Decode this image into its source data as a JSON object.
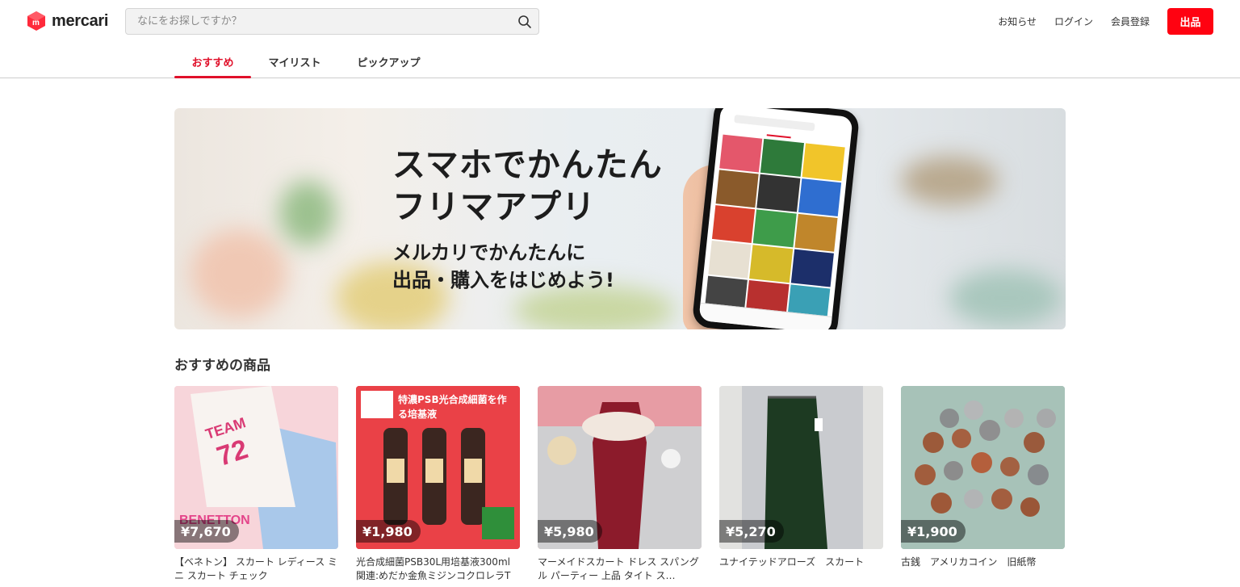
{
  "header": {
    "logo_text": "mercari",
    "search_placeholder": "なにをお探しですか？",
    "nav": [
      "お知らせ",
      "ログイン",
      "会員登録"
    ],
    "sell_label": "出品"
  },
  "tabs": [
    "おすすめ",
    "マイリスト",
    "ピックアップ"
  ],
  "banner": {
    "headline_1": "スマホでかんたん",
    "headline_2": "フリマアプリ",
    "sub_1": "メルカリでかんたんに",
    "sub_2": "出品・購入をはじめよう!"
  },
  "section_title": "おすすめの商品",
  "items": [
    {
      "price": "¥7,670",
      "title": "【ベネトン】 スカート レディース ミニ スカート チェック",
      "brand_text": "BENETTON"
    },
    {
      "price": "¥1,980",
      "title": "光合成細菌PSB30L用培基液300ml 関連:めだか金魚ミジンコクロレラT",
      "banner_text": "特濃PSB光合成細菌を作る培基液"
    },
    {
      "price": "¥5,980",
      "title": "マーメイドスカート ドレス スパングル パーティー 上品 タイト ス…"
    },
    {
      "price": "¥5,270",
      "title": "ユナイテッドアローズ　スカート"
    },
    {
      "price": "¥1,900",
      "title": "古銭　アメリカコイン　旧紙幣"
    }
  ],
  "colors": {
    "accent": "#ff0211",
    "tab_active": "#e0102a"
  }
}
